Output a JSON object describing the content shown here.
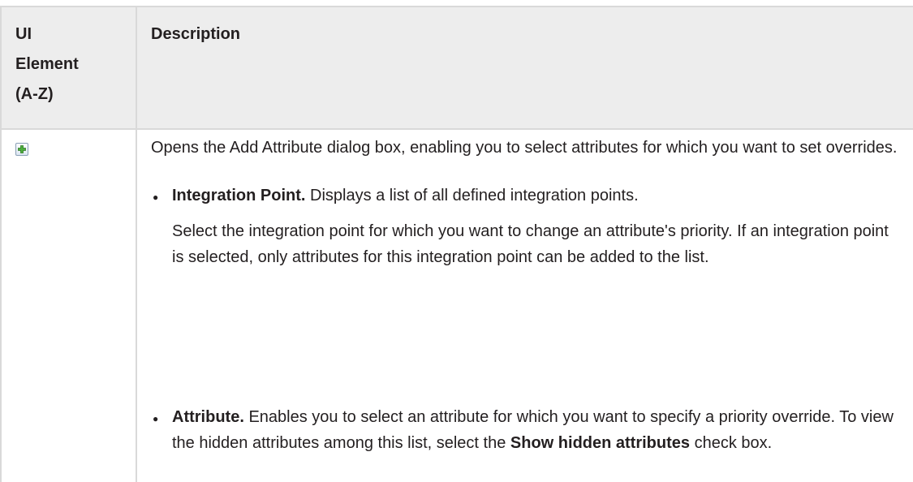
{
  "table": {
    "header": {
      "col1_lines": [
        "UI",
        "Element",
        "(A-Z)"
      ],
      "col2": "Description"
    },
    "row": {
      "icon": "add-icon",
      "intro": "Opens the Add Attribute dialog box, enabling you to select attributes for which you want to set overrides.",
      "items": [
        {
          "term": "Integration Point.",
          "text": " Displays a list of all defined integration points.",
          "sub": "Select the integration point for which you want to change an attribute's priority. If an integration point is selected, only attributes for this integration point can be added to the list."
        },
        {
          "term": "Attribute.",
          "text": " Enables you to select an attribute for which you want to specify a priority override. To view the hidden attributes among this list, select the ",
          "bold_tail": "Show hidden attributes",
          "tail": " check box."
        }
      ]
    }
  }
}
